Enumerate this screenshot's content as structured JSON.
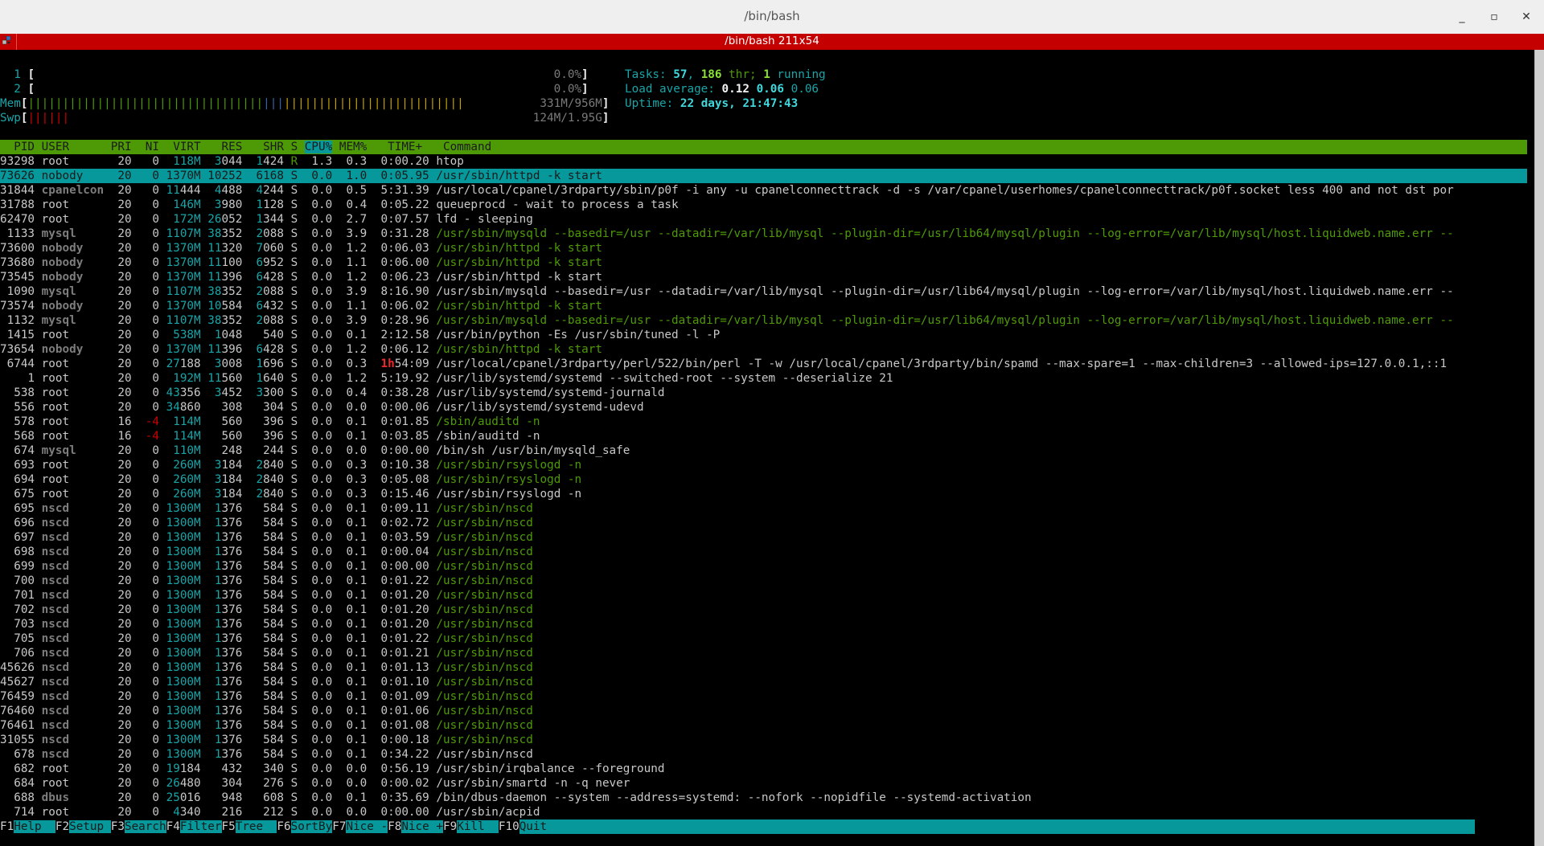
{
  "window": {
    "title": "/bin/bash",
    "tab_title": "/bin/bash 211x54",
    "controls": {
      "minimize": "_",
      "maximize": "▫",
      "close": "✕"
    }
  },
  "meters": {
    "cpu": [
      {
        "label": "1",
        "value_text": "0.0%",
        "percent": 0.0
      },
      {
        "label": "2",
        "value_text": "0.0%",
        "percent": 0.0
      }
    ],
    "mem": {
      "label": "Mem",
      "value_text": "331M/956M",
      "bars": {
        "used_green": 34,
        "buffers_blue": 3,
        "cache_yellow": 26
      }
    },
    "swap": {
      "label": "Swp",
      "value_text": "124M/1.95G",
      "bars": {
        "used_red": 6
      }
    },
    "tasks": {
      "label": "Tasks: ",
      "tasks": "57",
      "sep": ", ",
      "threads": "186",
      "thr_label": " thr; ",
      "running": "1",
      "running_label": " running"
    },
    "load": {
      "label": "Load average: ",
      "one": "0.12",
      "five": "0.06",
      "fifteen": "0.06"
    },
    "uptime": {
      "label": "Uptime: ",
      "value": "22 days, 21:47:43"
    }
  },
  "table": {
    "columns": [
      "PID",
      "USER",
      "PRI",
      "NI",
      "VIRT",
      "RES",
      "SHR",
      "S",
      "CPU%",
      "MEM%",
      "TIME+",
      "Command"
    ],
    "sorted_column": "CPU%",
    "selected_pid": "73626",
    "rows": [
      {
        "pid": "93298",
        "user": "root",
        "pri": "20",
        "ni": "0",
        "virt": "118M",
        "res": "3044",
        "shr": "1424",
        "s": "R",
        "cpu": "1.3",
        "mem": "0.3",
        "time": "0:00.20",
        "cmd": "htop",
        "thread": false
      },
      {
        "pid": "73626",
        "user": "nobody",
        "pri": "20",
        "ni": "0",
        "virt": "1370M",
        "res": "10252",
        "shr": "6168",
        "s": "S",
        "cpu": "0.0",
        "mem": "1.0",
        "time": "0:05.95",
        "cmd": "/usr/sbin/httpd -k start",
        "thread": false
      },
      {
        "pid": "31844",
        "user": "cpanelcon",
        "pri": "20",
        "ni": "0",
        "virt": "11444",
        "res": "4488",
        "shr": "4244",
        "s": "S",
        "cpu": "0.0",
        "mem": "0.5",
        "time": "5:31.39",
        "cmd": "/usr/local/cpanel/3rdparty/sbin/p0f -i any -u cpanelconnecttrack -d -s /var/cpanel/userhomes/cpanelconnecttrack/p0f.socket less 400 and not dst por",
        "thread": false
      },
      {
        "pid": "31788",
        "user": "root",
        "pri": "20",
        "ni": "0",
        "virt": "146M",
        "res": "3980",
        "shr": "1128",
        "s": "S",
        "cpu": "0.0",
        "mem": "0.4",
        "time": "0:05.22",
        "cmd": "queueprocd - wait to process a task",
        "thread": false
      },
      {
        "pid": "62470",
        "user": "root",
        "pri": "20",
        "ni": "0",
        "virt": "172M",
        "res": "26052",
        "shr": "1344",
        "s": "S",
        "cpu": "0.0",
        "mem": "2.7",
        "time": "0:07.57",
        "cmd": "lfd - sleeping",
        "thread": false
      },
      {
        "pid": "1133",
        "user": "mysql",
        "pri": "20",
        "ni": "0",
        "virt": "1107M",
        "res": "38352",
        "shr": "2088",
        "s": "S",
        "cpu": "0.0",
        "mem": "3.9",
        "time": "0:31.28",
        "cmd": "/usr/sbin/mysqld --basedir=/usr --datadir=/var/lib/mysql --plugin-dir=/usr/lib64/mysql/plugin --log-error=/var/lib/mysql/host.liquidweb.name.err --",
        "thread": true
      },
      {
        "pid": "73600",
        "user": "nobody",
        "pri": "20",
        "ni": "0",
        "virt": "1370M",
        "res": "11320",
        "shr": "7060",
        "s": "S",
        "cpu": "0.0",
        "mem": "1.2",
        "time": "0:06.03",
        "cmd": "/usr/sbin/httpd -k start",
        "thread": true
      },
      {
        "pid": "73680",
        "user": "nobody",
        "pri": "20",
        "ni": "0",
        "virt": "1370M",
        "res": "11100",
        "shr": "6952",
        "s": "S",
        "cpu": "0.0",
        "mem": "1.1",
        "time": "0:06.00",
        "cmd": "/usr/sbin/httpd -k start",
        "thread": true
      },
      {
        "pid": "73545",
        "user": "nobody",
        "pri": "20",
        "ni": "0",
        "virt": "1370M",
        "res": "11396",
        "shr": "6428",
        "s": "S",
        "cpu": "0.0",
        "mem": "1.2",
        "time": "0:06.23",
        "cmd": "/usr/sbin/httpd -k start",
        "thread": false
      },
      {
        "pid": "1090",
        "user": "mysql",
        "pri": "20",
        "ni": "0",
        "virt": "1107M",
        "res": "38352",
        "shr": "2088",
        "s": "S",
        "cpu": "0.0",
        "mem": "3.9",
        "time": "8:16.90",
        "cmd": "/usr/sbin/mysqld --basedir=/usr --datadir=/var/lib/mysql --plugin-dir=/usr/lib64/mysql/plugin --log-error=/var/lib/mysql/host.liquidweb.name.err --",
        "thread": false
      },
      {
        "pid": "73574",
        "user": "nobody",
        "pri": "20",
        "ni": "0",
        "virt": "1370M",
        "res": "10584",
        "shr": "6432",
        "s": "S",
        "cpu": "0.0",
        "mem": "1.1",
        "time": "0:06.02",
        "cmd": "/usr/sbin/httpd -k start",
        "thread": true
      },
      {
        "pid": "1132",
        "user": "mysql",
        "pri": "20",
        "ni": "0",
        "virt": "1107M",
        "res": "38352",
        "shr": "2088",
        "s": "S",
        "cpu": "0.0",
        "mem": "3.9",
        "time": "0:28.96",
        "cmd": "/usr/sbin/mysqld --basedir=/usr --datadir=/var/lib/mysql --plugin-dir=/usr/lib64/mysql/plugin --log-error=/var/lib/mysql/host.liquidweb.name.err --",
        "thread": true
      },
      {
        "pid": "1415",
        "user": "root",
        "pri": "20",
        "ni": "0",
        "virt": "538M",
        "res": "1048",
        "shr": "540",
        "s": "S",
        "cpu": "0.0",
        "mem": "0.1",
        "time": "2:12.58",
        "cmd": "/usr/bin/python -Es /usr/sbin/tuned -l -P",
        "thread": false
      },
      {
        "pid": "73654",
        "user": "nobody",
        "pri": "20",
        "ni": "0",
        "virt": "1370M",
        "res": "11396",
        "shr": "6428",
        "s": "S",
        "cpu": "0.0",
        "mem": "1.2",
        "time": "0:06.12",
        "cmd": "/usr/sbin/httpd -k start",
        "thread": true
      },
      {
        "pid": "6744",
        "user": "root",
        "pri": "20",
        "ni": "0",
        "virt": "27188",
        "res": "3008",
        "shr": "1696",
        "s": "S",
        "cpu": "0.0",
        "mem": "0.3",
        "time": "1h54:09",
        "cmd": "/usr/local/cpanel/3rdparty/perl/522/bin/perl -T -w /usr/local/cpanel/3rdparty/bin/spamd --max-spare=1 --max-children=3 --allowed-ips=127.0.0.1,::1",
        "thread": false
      },
      {
        "pid": "1",
        "user": "root",
        "pri": "20",
        "ni": "0",
        "virt": "192M",
        "res": "11560",
        "shr": "1640",
        "s": "S",
        "cpu": "0.0",
        "mem": "1.2",
        "time": "5:19.92",
        "cmd": "/usr/lib/systemd/systemd --switched-root --system --deserialize 21",
        "thread": false
      },
      {
        "pid": "538",
        "user": "root",
        "pri": "20",
        "ni": "0",
        "virt": "43356",
        "res": "3452",
        "shr": "3300",
        "s": "S",
        "cpu": "0.0",
        "mem": "0.4",
        "time": "0:38.28",
        "cmd": "/usr/lib/systemd/systemd-journald",
        "thread": false
      },
      {
        "pid": "556",
        "user": "root",
        "pri": "20",
        "ni": "0",
        "virt": "34860",
        "res": "308",
        "shr": "304",
        "s": "S",
        "cpu": "0.0",
        "mem": "0.0",
        "time": "0:00.06",
        "cmd": "/usr/lib/systemd/systemd-udevd",
        "thread": false
      },
      {
        "pid": "578",
        "user": "root",
        "pri": "16",
        "ni": "-4",
        "virt": "114M",
        "res": "560",
        "shr": "396",
        "s": "S",
        "cpu": "0.0",
        "mem": "0.1",
        "time": "0:01.85",
        "cmd": "/sbin/auditd -n",
        "thread": true
      },
      {
        "pid": "568",
        "user": "root",
        "pri": "16",
        "ni": "-4",
        "virt": "114M",
        "res": "560",
        "shr": "396",
        "s": "S",
        "cpu": "0.0",
        "mem": "0.1",
        "time": "0:03.85",
        "cmd": "/sbin/auditd -n",
        "thread": false
      },
      {
        "pid": "674",
        "user": "mysql",
        "pri": "20",
        "ni": "0",
        "virt": "110M",
        "res": "248",
        "shr": "244",
        "s": "S",
        "cpu": "0.0",
        "mem": "0.0",
        "time": "0:00.00",
        "cmd": "/bin/sh /usr/bin/mysqld_safe",
        "thread": false
      },
      {
        "pid": "693",
        "user": "root",
        "pri": "20",
        "ni": "0",
        "virt": "260M",
        "res": "3184",
        "shr": "2840",
        "s": "S",
        "cpu": "0.0",
        "mem": "0.3",
        "time": "0:10.38",
        "cmd": "/usr/sbin/rsyslogd -n",
        "thread": true
      },
      {
        "pid": "694",
        "user": "root",
        "pri": "20",
        "ni": "0",
        "virt": "260M",
        "res": "3184",
        "shr": "2840",
        "s": "S",
        "cpu": "0.0",
        "mem": "0.3",
        "time": "0:05.08",
        "cmd": "/usr/sbin/rsyslogd -n",
        "thread": true
      },
      {
        "pid": "675",
        "user": "root",
        "pri": "20",
        "ni": "0",
        "virt": "260M",
        "res": "3184",
        "shr": "2840",
        "s": "S",
        "cpu": "0.0",
        "mem": "0.3",
        "time": "0:15.46",
        "cmd": "/usr/sbin/rsyslogd -n",
        "thread": false
      },
      {
        "pid": "695",
        "user": "nscd",
        "pri": "20",
        "ni": "0",
        "virt": "1300M",
        "res": "1376",
        "shr": "584",
        "s": "S",
        "cpu": "0.0",
        "mem": "0.1",
        "time": "0:09.11",
        "cmd": "/usr/sbin/nscd",
        "thread": true
      },
      {
        "pid": "696",
        "user": "nscd",
        "pri": "20",
        "ni": "0",
        "virt": "1300M",
        "res": "1376",
        "shr": "584",
        "s": "S",
        "cpu": "0.0",
        "mem": "0.1",
        "time": "0:02.72",
        "cmd": "/usr/sbin/nscd",
        "thread": true
      },
      {
        "pid": "697",
        "user": "nscd",
        "pri": "20",
        "ni": "0",
        "virt": "1300M",
        "res": "1376",
        "shr": "584",
        "s": "S",
        "cpu": "0.0",
        "mem": "0.1",
        "time": "0:03.59",
        "cmd": "/usr/sbin/nscd",
        "thread": true
      },
      {
        "pid": "698",
        "user": "nscd",
        "pri": "20",
        "ni": "0",
        "virt": "1300M",
        "res": "1376",
        "shr": "584",
        "s": "S",
        "cpu": "0.0",
        "mem": "0.1",
        "time": "0:00.04",
        "cmd": "/usr/sbin/nscd",
        "thread": true
      },
      {
        "pid": "699",
        "user": "nscd",
        "pri": "20",
        "ni": "0",
        "virt": "1300M",
        "res": "1376",
        "shr": "584",
        "s": "S",
        "cpu": "0.0",
        "mem": "0.1",
        "time": "0:00.00",
        "cmd": "/usr/sbin/nscd",
        "thread": true
      },
      {
        "pid": "700",
        "user": "nscd",
        "pri": "20",
        "ni": "0",
        "virt": "1300M",
        "res": "1376",
        "shr": "584",
        "s": "S",
        "cpu": "0.0",
        "mem": "0.1",
        "time": "0:01.22",
        "cmd": "/usr/sbin/nscd",
        "thread": true
      },
      {
        "pid": "701",
        "user": "nscd",
        "pri": "20",
        "ni": "0",
        "virt": "1300M",
        "res": "1376",
        "shr": "584",
        "s": "S",
        "cpu": "0.0",
        "mem": "0.1",
        "time": "0:01.20",
        "cmd": "/usr/sbin/nscd",
        "thread": true
      },
      {
        "pid": "702",
        "user": "nscd",
        "pri": "20",
        "ni": "0",
        "virt": "1300M",
        "res": "1376",
        "shr": "584",
        "s": "S",
        "cpu": "0.0",
        "mem": "0.1",
        "time": "0:01.20",
        "cmd": "/usr/sbin/nscd",
        "thread": true
      },
      {
        "pid": "703",
        "user": "nscd",
        "pri": "20",
        "ni": "0",
        "virt": "1300M",
        "res": "1376",
        "shr": "584",
        "s": "S",
        "cpu": "0.0",
        "mem": "0.1",
        "time": "0:01.20",
        "cmd": "/usr/sbin/nscd",
        "thread": true
      },
      {
        "pid": "705",
        "user": "nscd",
        "pri": "20",
        "ni": "0",
        "virt": "1300M",
        "res": "1376",
        "shr": "584",
        "s": "S",
        "cpu": "0.0",
        "mem": "0.1",
        "time": "0:01.22",
        "cmd": "/usr/sbin/nscd",
        "thread": true
      },
      {
        "pid": "706",
        "user": "nscd",
        "pri": "20",
        "ni": "0",
        "virt": "1300M",
        "res": "1376",
        "shr": "584",
        "s": "S",
        "cpu": "0.0",
        "mem": "0.1",
        "time": "0:01.21",
        "cmd": "/usr/sbin/nscd",
        "thread": true
      },
      {
        "pid": "45626",
        "user": "nscd",
        "pri": "20",
        "ni": "0",
        "virt": "1300M",
        "res": "1376",
        "shr": "584",
        "s": "S",
        "cpu": "0.0",
        "mem": "0.1",
        "time": "0:01.13",
        "cmd": "/usr/sbin/nscd",
        "thread": true
      },
      {
        "pid": "45627",
        "user": "nscd",
        "pri": "20",
        "ni": "0",
        "virt": "1300M",
        "res": "1376",
        "shr": "584",
        "s": "S",
        "cpu": "0.0",
        "mem": "0.1",
        "time": "0:01.10",
        "cmd": "/usr/sbin/nscd",
        "thread": true
      },
      {
        "pid": "76459",
        "user": "nscd",
        "pri": "20",
        "ni": "0",
        "virt": "1300M",
        "res": "1376",
        "shr": "584",
        "s": "S",
        "cpu": "0.0",
        "mem": "0.1",
        "time": "0:01.09",
        "cmd": "/usr/sbin/nscd",
        "thread": true
      },
      {
        "pid": "76460",
        "user": "nscd",
        "pri": "20",
        "ni": "0",
        "virt": "1300M",
        "res": "1376",
        "shr": "584",
        "s": "S",
        "cpu": "0.0",
        "mem": "0.1",
        "time": "0:01.06",
        "cmd": "/usr/sbin/nscd",
        "thread": true
      },
      {
        "pid": "76461",
        "user": "nscd",
        "pri": "20",
        "ni": "0",
        "virt": "1300M",
        "res": "1376",
        "shr": "584",
        "s": "S",
        "cpu": "0.0",
        "mem": "0.1",
        "time": "0:01.08",
        "cmd": "/usr/sbin/nscd",
        "thread": true
      },
      {
        "pid": "31055",
        "user": "nscd",
        "pri": "20",
        "ni": "0",
        "virt": "1300M",
        "res": "1376",
        "shr": "584",
        "s": "S",
        "cpu": "0.0",
        "mem": "0.1",
        "time": "0:00.18",
        "cmd": "/usr/sbin/nscd",
        "thread": true
      },
      {
        "pid": "678",
        "user": "nscd",
        "pri": "20",
        "ni": "0",
        "virt": "1300M",
        "res": "1376",
        "shr": "584",
        "s": "S",
        "cpu": "0.0",
        "mem": "0.1",
        "time": "0:34.22",
        "cmd": "/usr/sbin/nscd",
        "thread": false
      },
      {
        "pid": "682",
        "user": "root",
        "pri": "20",
        "ni": "0",
        "virt": "19184",
        "res": "432",
        "shr": "340",
        "s": "S",
        "cpu": "0.0",
        "mem": "0.0",
        "time": "0:56.19",
        "cmd": "/usr/sbin/irqbalance --foreground",
        "thread": false
      },
      {
        "pid": "684",
        "user": "root",
        "pri": "20",
        "ni": "0",
        "virt": "26480",
        "res": "304",
        "shr": "276",
        "s": "S",
        "cpu": "0.0",
        "mem": "0.0",
        "time": "0:00.02",
        "cmd": "/usr/sbin/smartd -n -q never",
        "thread": false
      },
      {
        "pid": "688",
        "user": "dbus",
        "pri": "20",
        "ni": "0",
        "virt": "25016",
        "res": "948",
        "shr": "608",
        "s": "S",
        "cpu": "0.0",
        "mem": "0.1",
        "time": "0:35.69",
        "cmd": "/bin/dbus-daemon --system --address=systemd: --nofork --nopidfile --systemd-activation",
        "thread": false
      },
      {
        "pid": "714",
        "user": "root",
        "pri": "20",
        "ni": "0",
        "virt": "4340",
        "res": "216",
        "shr": "212",
        "s": "S",
        "cpu": "0.0",
        "mem": "0.0",
        "time": "0:00.00",
        "cmd": "/usr/sbin/acpid",
        "thread": false
      }
    ]
  },
  "fkeys": [
    {
      "key": "F1",
      "label": "Help  "
    },
    {
      "key": "F2",
      "label": "Setup "
    },
    {
      "key": "F3",
      "label": "Search"
    },
    {
      "key": "F4",
      "label": "Filter"
    },
    {
      "key": "F5",
      "label": "Tree  "
    },
    {
      "key": "F6",
      "label": "SortBy"
    },
    {
      "key": "F7",
      "label": "Nice -"
    },
    {
      "key": "F8",
      "label": "Nice +"
    },
    {
      "key": "F9",
      "label": "Kill  "
    },
    {
      "key": "F10",
      "label": "Quit"
    }
  ],
  "colors": {
    "tab_bar": "#c40000",
    "header_bg": "#4e9a06",
    "selection_bg": "#06989a",
    "thread_cmd": "#4e9a06"
  }
}
